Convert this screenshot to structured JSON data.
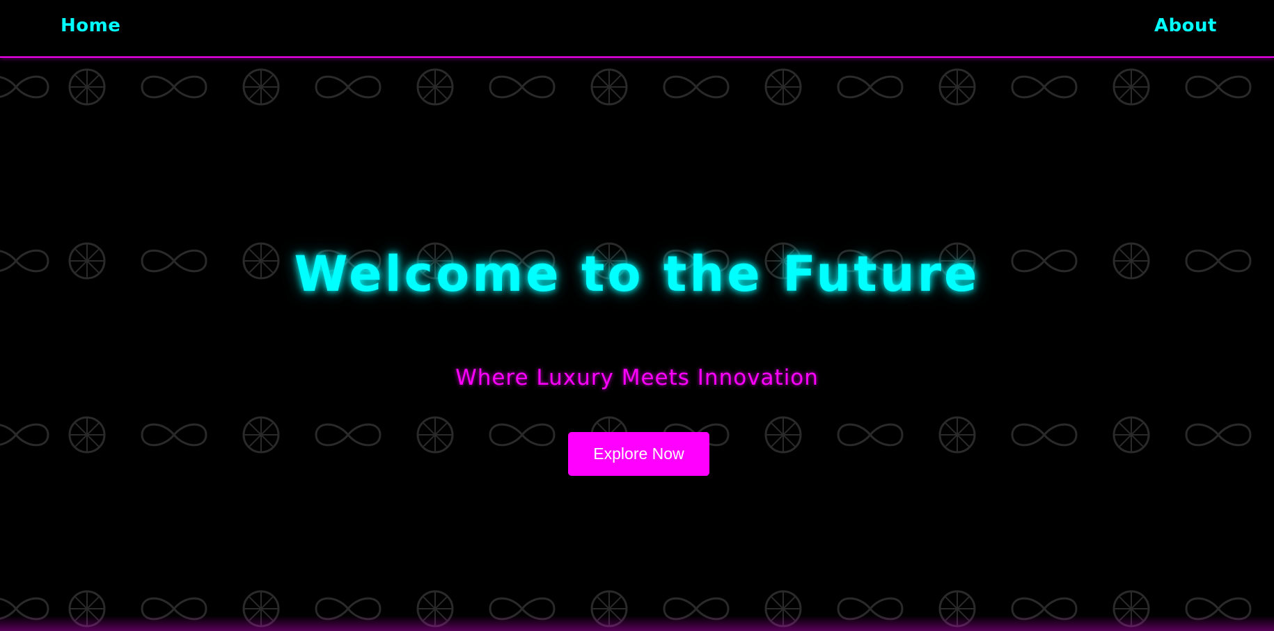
{
  "nav": {
    "home_label": "Home",
    "about_label": "About"
  },
  "hero": {
    "title": "Welcome to the Future",
    "subtitle": "Where Luxury Meets Innovation",
    "cta_label": "Explore Now"
  },
  "pattern": {
    "icons": [
      "infinity-icon",
      "wheel-icon"
    ]
  },
  "colors": {
    "background": "#000000",
    "accent_cyan": "#00ffff",
    "accent_magenta": "#ff00ff",
    "pattern_stroke": "#2a2a2a"
  }
}
